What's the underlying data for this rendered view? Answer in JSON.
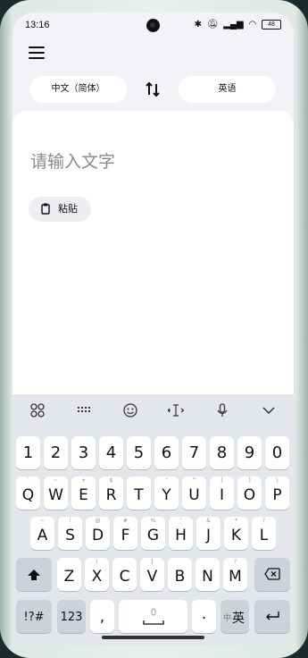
{
  "status": {
    "time": "13:16",
    "battery": "48"
  },
  "header": {
    "source_lang": "中文（简体）",
    "target_lang": "英语"
  },
  "editor": {
    "placeholder": "请输入文字",
    "paste_label": "粘贴"
  },
  "keyboard": {
    "numbers": [
      "1",
      "2",
      "3",
      "4",
      "5",
      "6",
      "7",
      "8",
      "9",
      "0"
    ],
    "row1": {
      "keys": [
        "Q",
        "W",
        "E",
        "R",
        "T",
        "Y",
        "U",
        "I",
        "O",
        "P"
      ],
      "subs": [
        "`",
        "~",
        "+",
        "$",
        "",
        "\"",
        "^",
        "[",
        "]",
        "\\"
      ]
    },
    "row2": {
      "keys": [
        "A",
        "S",
        "D",
        "F",
        "G",
        "H",
        "J",
        "K",
        "L"
      ],
      "subs": [
        "~",
        "!",
        "@",
        "#",
        "%",
        "'",
        "&",
        "*",
        "?"
      ]
    },
    "row3": {
      "keys": [
        "Z",
        "X",
        "C",
        "V",
        "B",
        "N",
        "M"
      ],
      "subs": [
        "",
        "(",
        "",
        "}",
        "",
        "",
        "?"
      ]
    },
    "bottom": {
      "symbols": "!?#",
      "num": "123",
      "comma": ",",
      "dot": ".",
      "lang_small": "中",
      "lang_big": "英"
    }
  },
  "icons": [
    "menu-icon",
    "swap-icon",
    "clipboard-icon",
    "apps-icon",
    "keyboard-icon",
    "emoji-icon",
    "cursor-icon",
    "mic-icon",
    "collapse-icon",
    "shift-icon",
    "backspace-icon",
    "enter-icon",
    "space-mic-icon"
  ]
}
